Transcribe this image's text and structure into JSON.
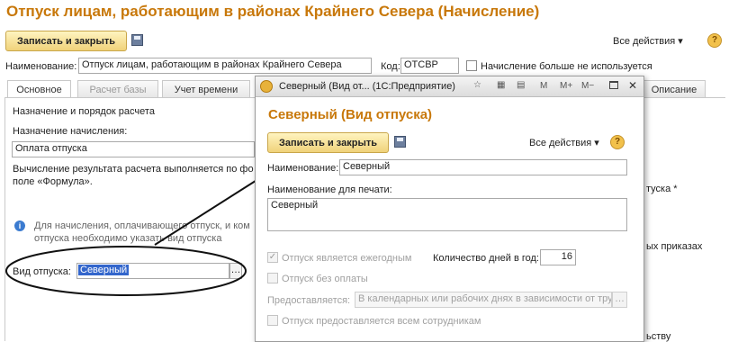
{
  "window": {
    "title": "Отпуск лицам, работающим в районах Крайнего Севера (Начисление)",
    "save_close_label": "Записать и закрыть",
    "all_actions_label": "Все действия",
    "name_label": "Наименование:",
    "name_value": "Отпуск лицам, работающим в районах Крайнего Севера",
    "code_label": "Код:",
    "code_value": "ОТСВР",
    "not_used_label": "Начисление больше не используется",
    "tabs": [
      {
        "label": "Основное"
      },
      {
        "label": "Расчет базы"
      },
      {
        "label": "Учет времени"
      },
      {
        "label": "Описание"
      }
    ],
    "purpose_header": "Назначение и порядок расчета",
    "purpose_label": "Назначение начисления:",
    "purpose_value": "Оплата отпуска",
    "calc_text_1": "Вычисление результата расчета выполняется по фо",
    "calc_text_2": "поле «Формула».",
    "info_text_1": "Для начисления, оплачивающего отпуск, и ком",
    "info_text_2": "отпуска необходимо указать вид отпуска",
    "leave_type_label": "Вид отпуска:",
    "leave_type_value": "Северный",
    "right_fragment_1": "туска *",
    "right_fragment_2": "ых приказах",
    "right_fragment_3": "ьству"
  },
  "dialog": {
    "window_title": "Северный (Вид от...  (1С:Предприятие)",
    "heading": "Северный (Вид отпуска)",
    "save_close_label": "Записать и закрыть",
    "all_actions_label": "Все действия",
    "name_label": "Наименование:",
    "name_value": "Северный",
    "print_name_label": "Наименование для печати:",
    "print_name_value": "Северный",
    "annual_label": "Отпуск является ежегодным",
    "annual_checked": true,
    "days_label": "Количество дней в год:",
    "days_value": "16",
    "unpaid_label": "Отпуск без оплаты",
    "provided_label": "Предоставляется:",
    "provided_value": "В календарных или рабочих днях в зависимости от труд",
    "all_employees_label": "Отпуск предоставляется всем сотрудникам",
    "toolbar_icons": [
      "star-icon",
      "calculator-icon",
      "calendar-icon",
      "m-icon",
      "m-plus-icon",
      "m-minus-icon",
      "maximize-icon",
      "close-icon"
    ],
    "toolbar_labels": {
      "m": "M",
      "m_plus": "M+",
      "m_minus": "M−",
      "close": "✕"
    }
  }
}
